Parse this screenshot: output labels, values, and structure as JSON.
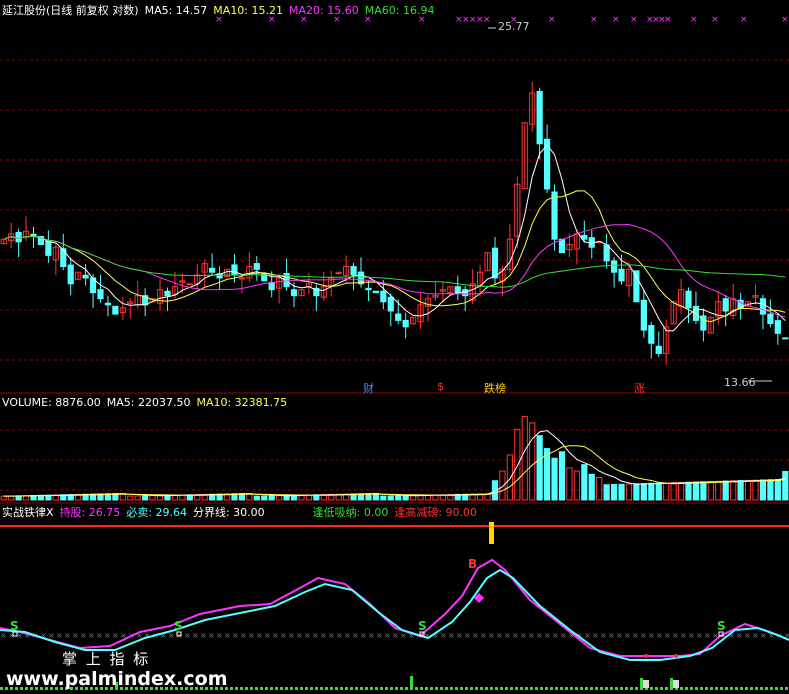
{
  "header": {
    "title": "延江股份(日线 前复权 对数)",
    "ma5": "MA5: 14.57",
    "ma10": "MA10: 15.21",
    "ma20": "MA20: 15.60",
    "ma60": "MA60: 16.94"
  },
  "volume_header": {
    "volume": "VOLUME: 8876.00",
    "ma5": "MA5: 22037.50",
    "ma10": "MA10: 32381.75"
  },
  "indicator_header": {
    "name": "实战铁律X",
    "hold": "持股: 26.75",
    "sell": "必卖: 29.64",
    "line": "分界线: 30.00",
    "low_buy": "逢低吸纳: 0.00",
    "high_sell": "逢高减磅: 90.00"
  },
  "event_tags": [
    {
      "text": "财",
      "color": "#3b8cff"
    },
    {
      "text": "$",
      "color": "#ff3333"
    },
    {
      "text": "跌榜",
      "color": "#ffd400"
    },
    {
      "text": "涨",
      "color": "#ff3333"
    }
  ],
  "signals": {
    "buy": "B",
    "sell": "S"
  },
  "watermark": {
    "line1": "掌 上 指 标",
    "line2": "www.palmindex.com"
  },
  "colors": {
    "up": "#ff3333",
    "down": "#54ffff",
    "ma5": "#ffffff",
    "ma10": "#ffff55",
    "ma20": "#ff33ff",
    "ma60": "#33dd33",
    "grid": "#8b0000",
    "bg": "#000000"
  },
  "chart_data": [
    {
      "type": "candlestick",
      "title": "延江股份(日线 前复权 对数)",
      "annotations": [
        "25.77",
        "13.66"
      ],
      "price_range": [
        12.5,
        27.5
      ],
      "series": [
        {
          "name": "MA5",
          "last": 14.57
        },
        {
          "name": "MA10",
          "last": 15.21
        },
        {
          "name": "MA20",
          "last": 15.6
        },
        {
          "name": "MA60",
          "last": 16.94
        }
      ],
      "close": [
        17.0,
        17.2,
        16.9,
        17.3,
        17.1,
        16.8,
        16.4,
        16.7,
        16.0,
        15.4,
        15.8,
        15.6,
        15.1,
        14.9,
        14.7,
        14.4,
        14.6,
        14.8,
        15.0,
        14.7,
        14.9,
        15.2,
        15.0,
        15.3,
        15.5,
        15.4,
        15.7,
        16.1,
        15.8,
        15.6,
        15.9,
        15.7,
        15.6,
        16.0,
        15.9,
        15.5,
        15.2,
        15.6,
        15.3,
        15.0,
        15.2,
        15.4,
        15.0,
        15.3,
        15.6,
        15.8,
        16.0,
        15.7,
        15.4,
        15.2,
        15.1,
        14.8,
        14.5,
        14.2,
        14.0,
        14.3,
        14.7,
        14.9,
        15.0,
        15.2,
        15.3,
        15.1,
        15.0,
        15.4,
        15.8,
        16.5,
        15.6,
        15.9,
        17.0,
        19.2,
        22.0,
        23.5,
        21.0,
        19.0,
        17.0,
        16.5,
        16.8,
        17.2,
        17.0,
        16.7,
        16.9,
        16.2,
        15.8,
        15.5,
        15.9,
        14.8,
        13.9,
        13.5,
        13.2,
        14.0,
        14.8,
        15.2,
        14.6,
        14.2,
        13.9,
        14.3,
        14.8,
        14.5,
        14.9,
        14.6,
        14.8,
        15.0,
        14.4,
        14.1,
        13.8,
        13.66
      ],
      "volume_last": 8876.0
    },
    {
      "type": "line",
      "title": "实战铁律X",
      "series": [
        {
          "name": "持股",
          "last": 26.75
        },
        {
          "name": "必卖",
          "last": 29.64
        }
      ],
      "thresholds": {
        "分界线": 30.0,
        "逢低吸纳": 0.0,
        "逢高减磅": 90.0
      }
    }
  ]
}
